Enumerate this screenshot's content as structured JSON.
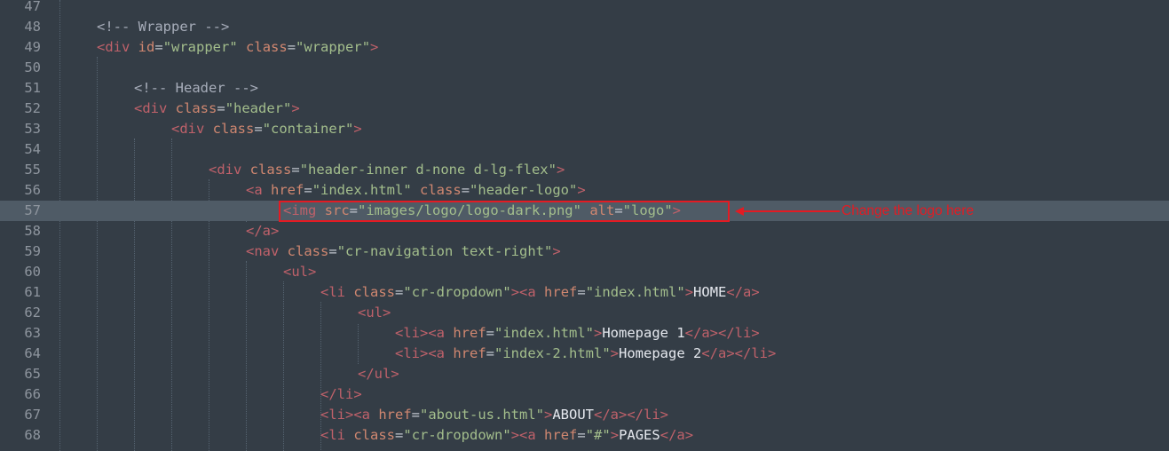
{
  "editor": {
    "lines": [
      {
        "num": "47",
        "segs": []
      },
      {
        "num": "48",
        "segs": [
          [
            "cmt",
            "<!-- Wrapper -->"
          ]
        ]
      },
      {
        "num": "49",
        "segs": [
          [
            "tag",
            "<div"
          ],
          [
            "txt",
            " "
          ],
          [
            "attr",
            "id"
          ],
          [
            "punc",
            "="
          ],
          [
            "str",
            "\"wrapper\""
          ],
          [
            "txt",
            " "
          ],
          [
            "attr",
            "class"
          ],
          [
            "punc",
            "="
          ],
          [
            "str",
            "\"wrapper\""
          ],
          [
            "tag",
            ">"
          ]
        ]
      },
      {
        "num": "50",
        "segs": []
      },
      {
        "num": "51",
        "segs": [
          [
            "cmt",
            "<!-- Header -->"
          ]
        ]
      },
      {
        "num": "52",
        "segs": [
          [
            "tag",
            "<div"
          ],
          [
            "txt",
            " "
          ],
          [
            "attr",
            "class"
          ],
          [
            "punc",
            "="
          ],
          [
            "str",
            "\"header\""
          ],
          [
            "tag",
            ">"
          ]
        ]
      },
      {
        "num": "53",
        "segs": [
          [
            "tag",
            "<div"
          ],
          [
            "txt",
            " "
          ],
          [
            "attr",
            "class"
          ],
          [
            "punc",
            "="
          ],
          [
            "str",
            "\"container\""
          ],
          [
            "tag",
            ">"
          ]
        ]
      },
      {
        "num": "54",
        "segs": []
      },
      {
        "num": "55",
        "segs": [
          [
            "tag",
            "<div"
          ],
          [
            "txt",
            " "
          ],
          [
            "attr",
            "class"
          ],
          [
            "punc",
            "="
          ],
          [
            "str",
            "\"header-inner d-none d-lg-flex\""
          ],
          [
            "tag",
            ">"
          ]
        ]
      },
      {
        "num": "56",
        "segs": [
          [
            "tag",
            "<a"
          ],
          [
            "txt",
            " "
          ],
          [
            "attr",
            "href"
          ],
          [
            "punc",
            "="
          ],
          [
            "str",
            "\"index.html\""
          ],
          [
            "txt",
            " "
          ],
          [
            "attr",
            "class"
          ],
          [
            "punc",
            "="
          ],
          [
            "str",
            "\"header-logo\""
          ],
          [
            "tag",
            ">"
          ]
        ]
      },
      {
        "num": "57",
        "segs": [
          [
            "tag",
            "<img"
          ],
          [
            "txt",
            " "
          ],
          [
            "attr",
            "src"
          ],
          [
            "punc",
            "="
          ],
          [
            "str",
            "\"images/logo/logo-dark.png\""
          ],
          [
            "txt",
            " "
          ],
          [
            "attr",
            "alt"
          ],
          [
            "punc",
            "="
          ],
          [
            "str",
            "\"logo\""
          ],
          [
            "tag",
            ">"
          ]
        ]
      },
      {
        "num": "58",
        "segs": [
          [
            "tag",
            "</a>"
          ]
        ]
      },
      {
        "num": "59",
        "segs": [
          [
            "tag",
            "<nav"
          ],
          [
            "txt",
            " "
          ],
          [
            "attr",
            "class"
          ],
          [
            "punc",
            "="
          ],
          [
            "str",
            "\"cr-navigation text-right\""
          ],
          [
            "tag",
            ">"
          ]
        ]
      },
      {
        "num": "60",
        "segs": [
          [
            "tag",
            "<ul>"
          ]
        ]
      },
      {
        "num": "61",
        "segs": [
          [
            "tag",
            "<li"
          ],
          [
            "txt",
            " "
          ],
          [
            "attr",
            "class"
          ],
          [
            "punc",
            "="
          ],
          [
            "str",
            "\"cr-dropdown\""
          ],
          [
            "tag",
            ">"
          ],
          [
            "tag",
            "<a"
          ],
          [
            "txt",
            " "
          ],
          [
            "attr",
            "href"
          ],
          [
            "punc",
            "="
          ],
          [
            "str",
            "\"index.html\""
          ],
          [
            "tag",
            ">"
          ],
          [
            "txt",
            "HOME"
          ],
          [
            "tag",
            "</a>"
          ]
        ]
      },
      {
        "num": "62",
        "segs": [
          [
            "tag",
            "<ul>"
          ]
        ]
      },
      {
        "num": "63",
        "segs": [
          [
            "tag",
            "<li>"
          ],
          [
            "tag",
            "<a"
          ],
          [
            "txt",
            " "
          ],
          [
            "attr",
            "href"
          ],
          [
            "punc",
            "="
          ],
          [
            "str",
            "\"index.html\""
          ],
          [
            "tag",
            ">"
          ],
          [
            "txt",
            "Homepage 1"
          ],
          [
            "tag",
            "</a>"
          ],
          [
            "tag",
            "</li>"
          ]
        ]
      },
      {
        "num": "64",
        "segs": [
          [
            "tag",
            "<li>"
          ],
          [
            "tag",
            "<a"
          ],
          [
            "txt",
            " "
          ],
          [
            "attr",
            "href"
          ],
          [
            "punc",
            "="
          ],
          [
            "str",
            "\"index-2.html\""
          ],
          [
            "tag",
            ">"
          ],
          [
            "txt",
            "Homepage 2"
          ],
          [
            "tag",
            "</a>"
          ],
          [
            "tag",
            "</li>"
          ]
        ]
      },
      {
        "num": "65",
        "segs": [
          [
            "tag",
            "</ul>"
          ]
        ]
      },
      {
        "num": "66",
        "segs": [
          [
            "tag",
            "</li>"
          ]
        ]
      },
      {
        "num": "67",
        "segs": [
          [
            "tag",
            "<li>"
          ],
          [
            "tag",
            "<a"
          ],
          [
            "txt",
            " "
          ],
          [
            "attr",
            "href"
          ],
          [
            "punc",
            "="
          ],
          [
            "str",
            "\"about-us.html\""
          ],
          [
            "tag",
            ">"
          ],
          [
            "txt",
            "ABOUT"
          ],
          [
            "tag",
            "</a>"
          ],
          [
            "tag",
            "</li>"
          ]
        ]
      },
      {
        "num": "68",
        "segs": [
          [
            "tag",
            "<li"
          ],
          [
            "txt",
            " "
          ],
          [
            "attr",
            "class"
          ],
          [
            "punc",
            "="
          ],
          [
            "str",
            "\"cr-dropdown\""
          ],
          [
            "tag",
            ">"
          ],
          [
            "tag",
            "<a"
          ],
          [
            "txt",
            " "
          ],
          [
            "attr",
            "href"
          ],
          [
            "punc",
            "="
          ],
          [
            "str",
            "\"#\""
          ],
          [
            "tag",
            ">"
          ],
          [
            "txt",
            "PAGES"
          ],
          [
            "tag",
            "</a>"
          ]
        ]
      }
    ]
  },
  "annotation": {
    "label": "Change the logo here",
    "color": "#e31b23"
  }
}
